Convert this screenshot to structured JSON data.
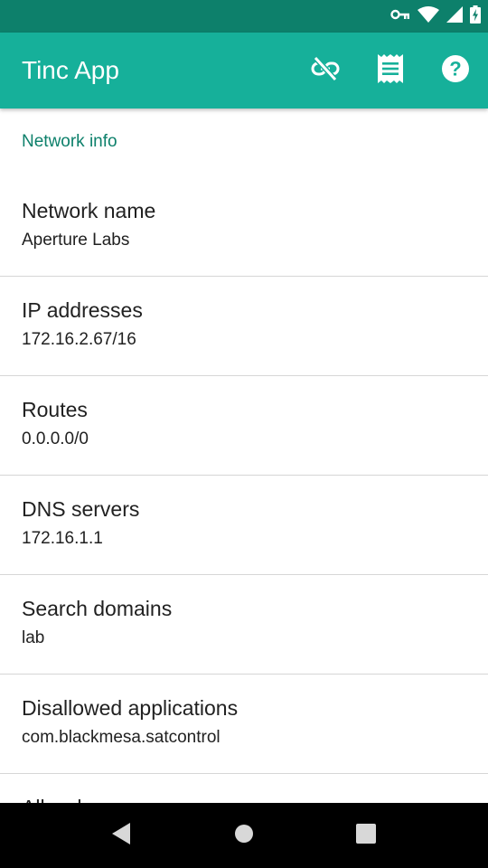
{
  "status_bar": {
    "icons": [
      "vpn-key-icon",
      "wifi-icon",
      "cell-signal-icon",
      "battery-charging-icon"
    ]
  },
  "app_bar": {
    "title": "Tinc App",
    "actions": [
      "link-off-icon",
      "receipt-log-icon",
      "help-icon"
    ]
  },
  "content": {
    "section_header": "Network info",
    "items": [
      {
        "title": "Network name",
        "summary": "Aperture Labs"
      },
      {
        "title": "IP addresses",
        "summary": "172.16.2.67/16"
      },
      {
        "title": "Routes",
        "summary": "0.0.0.0/0"
      },
      {
        "title": "DNS servers",
        "summary": "172.16.1.1"
      },
      {
        "title": "Search domains",
        "summary": "lab"
      },
      {
        "title": "Disallowed applications",
        "summary": "com.blackmesa.satcontrol"
      },
      {
        "title": "Allow bypass",
        "summary": ""
      }
    ]
  },
  "nav_bar": {
    "buttons": [
      "back-icon",
      "home-icon",
      "recents-icon"
    ]
  },
  "colors": {
    "status_bar": "#0d806b",
    "app_bar": "#16b09a",
    "accent": "#0d806b"
  }
}
